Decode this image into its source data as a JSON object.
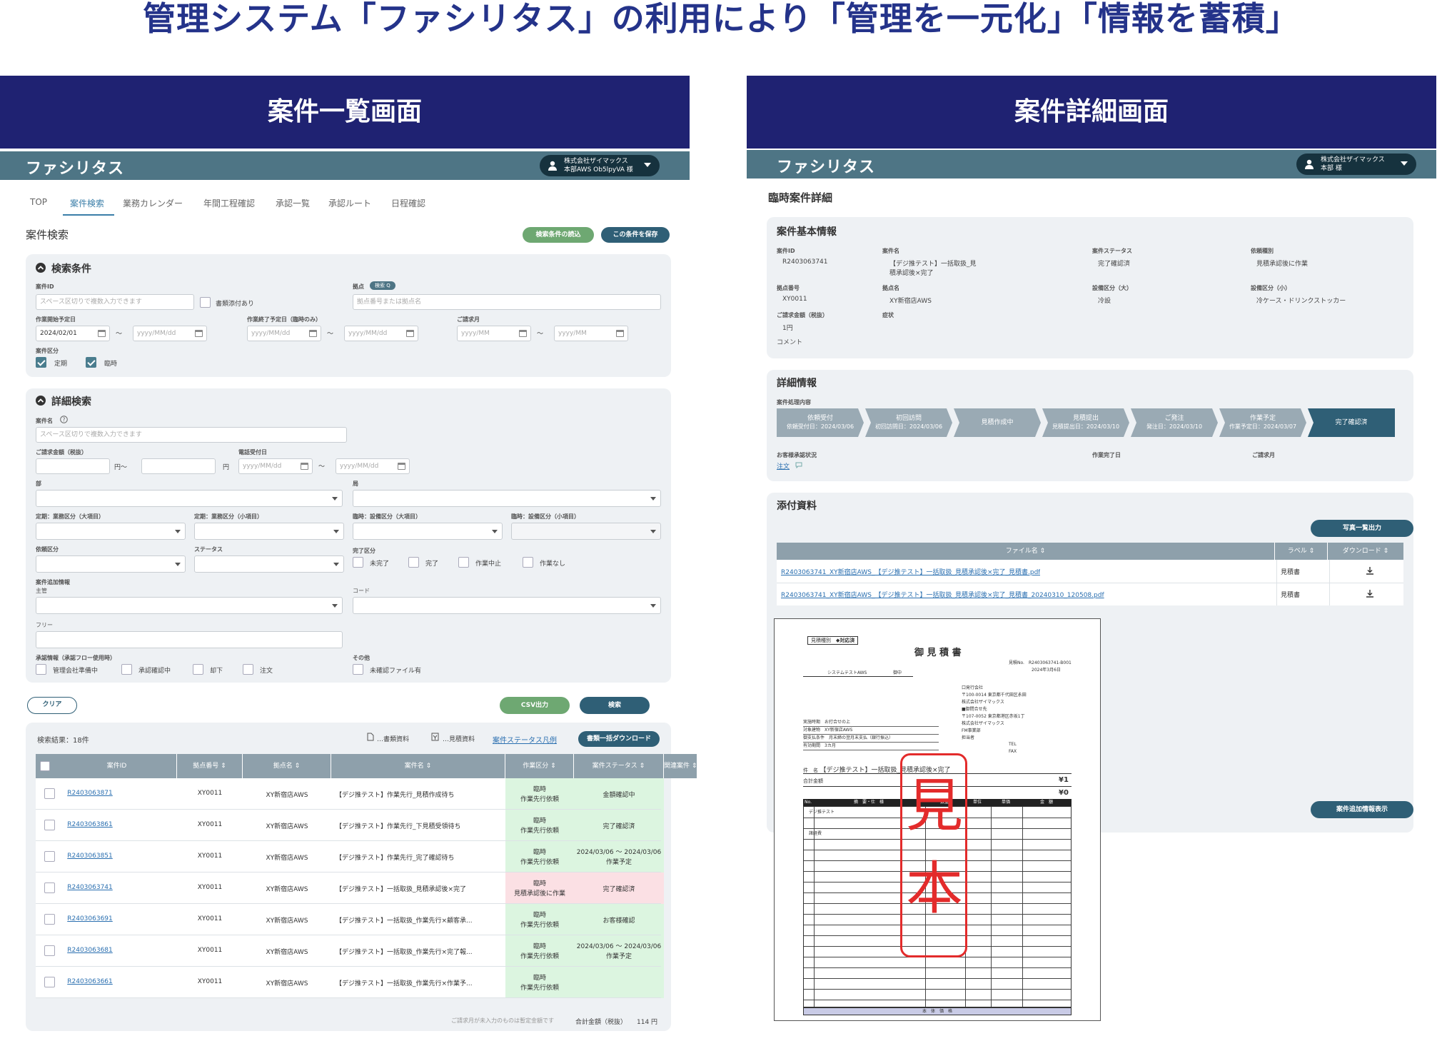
{
  "headline": "管理システム「ファシリタス」の利用により「管理を一元化」「情報を蓄積」",
  "left": {
    "banner": "案件一覧画面",
    "logo": "ファシリタス",
    "user": {
      "line1": "株式会社ザイマックス",
      "line2": "本部AWS Ob5lpyVA 様"
    },
    "tabs": [
      "TOP",
      "案件検索",
      "業務カレンダー",
      "年間工程確認",
      "承認一覧",
      "承認ルート",
      "日程確認"
    ],
    "page_title": "案件検索",
    "btn_load": "検索条件の読込",
    "btn_save": "この条件を保存",
    "cond": {
      "title": "検索条件",
      "case_id_label": "案件ID",
      "case_id_ph": "スペース区切りで複数入力できます",
      "attach_label": "書類添付あり",
      "site_label": "拠点",
      "site_badge": "検索 Q",
      "site_ph": "拠点番号または拠点名",
      "start_label": "作業開始予定日",
      "start_val": "2024/02/01",
      "date_ph": "yyyy/MM/dd",
      "tilde": "〜",
      "end_label": "作業終了予定日（臨時のみ）",
      "bill_label": "ご請求月",
      "month_ph": "yyyy/MM",
      "kind_label": "案件区分",
      "kind_a": "定期",
      "kind_b": "臨時"
    },
    "detail": {
      "title": "詳細検索",
      "name_label": "案件名",
      "name_ph": "スペース区切りで複数入力できます",
      "amount_label": "ご請求金額（税抜）",
      "yen_from": "円〜",
      "yen": "円",
      "tel_label": "電話受付日",
      "bu_label": "部",
      "ka_label": "局",
      "t_big": "定期：業務区分（大項目）",
      "t_small": "定期：業務区分（小項目）",
      "r_big": "臨時：設備区分（大項目）",
      "r_small": "臨時：設備区分（小項目）",
      "req_label": "依頼区分",
      "status_label": "ステータス",
      "done_label": "完了区分",
      "done_opts": [
        "未完了",
        "完了",
        "作業中止",
        "作業なし"
      ],
      "extra_label": "案件追加情報",
      "owner_label": "主管",
      "code_label": "コード",
      "free_label": "フリー",
      "approve_label": "承認情報（承認フロー使用時）",
      "approve_opts": [
        "管理会社準備中",
        "承認確認中",
        "却下",
        "注文"
      ],
      "other_label": "その他",
      "other_opt": "未確認ファイル有"
    },
    "btn_clear": "クリア",
    "btn_csv": "CSV出力",
    "btn_search": "検索",
    "results": {
      "count": "検索結果：18件",
      "legend1": "…書類資料",
      "legend2": "…見積資料",
      "legend_link": "案件ステータス凡例",
      "btn_bulk": "書類一括ダウンロード",
      "headers": [
        "案件ID",
        "拠点番号",
        "拠点名",
        "案件名",
        "作業区分",
        "案件ステータス",
        "関連案件"
      ],
      "rows": [
        {
          "id": "R2403063871",
          "no": "XY0011",
          "site": "XY新宿店AWS",
          "name": "【デジ推テスト】作業先行_見積作成待ち",
          "kind": "臨時\n作業先行依頼",
          "status": "金額確認中",
          "pink": false
        },
        {
          "id": "R2403063861",
          "no": "XY0011",
          "site": "XY新宿店AWS",
          "name": "【デジ推テスト】作業先行_下見積受領待ち",
          "kind": "臨時\n作業先行依頼",
          "status": "完了確認済",
          "pink": false
        },
        {
          "id": "R2403063851",
          "no": "XY0011",
          "site": "XY新宿店AWS",
          "name": "【デジ推テスト】作業先行_完了確認待ち",
          "kind": "臨時\n作業先行依頼",
          "status": "2024/03/06 〜 2024/03/06\n作業予定",
          "pink": false
        },
        {
          "id": "R2403063741",
          "no": "XY0011",
          "site": "XY新宿店AWS",
          "name": "【デジ推テスト】一括取扱_見積承認後×完了",
          "kind": "臨時\n見積承認後に作業",
          "status": "完了確認済",
          "pink": true
        },
        {
          "id": "R2403063691",
          "no": "XY0011",
          "site": "XY新宿店AWS",
          "name": "【デジ推テスト】一括取扱_作業先行×顧客承...",
          "kind": "臨時\n作業先行依頼",
          "status": "お客様確認",
          "pink": false
        },
        {
          "id": "R2403063681",
          "no": "XY0011",
          "site": "XY新宿店AWS",
          "name": "【デジ推テスト】一括取扱_作業先行×完了報...",
          "kind": "臨時\n作業先行依頼",
          "status": "2024/03/06 〜 2024/03/06\n作業予定",
          "pink": false
        },
        {
          "id": "R2403063661",
          "no": "XY0011",
          "site": "XY新宿店AWS",
          "name": "【デジ推テスト】一括取扱_作業先行×作業予...",
          "kind": "臨時\n作業先行依頼",
          "status": "",
          "pink": false
        }
      ],
      "footer_note": "ご請求月が未入力のものは暫定金額です",
      "total_label": "合計金額（税抜）",
      "total_value": "114 円"
    }
  },
  "right": {
    "banner": "案件詳細画面",
    "logo": "ファシリタス",
    "user": {
      "line1": "株式会社ザイマックス",
      "line2": "本部 様"
    },
    "page_title": "臨時案件詳細",
    "basic": {
      "title": "案件基本情報",
      "id_label": "案件ID",
      "id_val": "R2403063741",
      "name_label": "案件名",
      "name_val1": "【デジ推テスト】一括取扱_見",
      "name_val2": "積承認後×完了",
      "status_label": "案件ステータス",
      "status_val": "完了確認済",
      "req_label": "依頼種別",
      "req_val": "見積承認後に作業",
      "siteno_label": "拠点番号",
      "siteno_val": "XY0011",
      "site_label": "拠点名",
      "site_val": "XY新宿店AWS",
      "eqbig_label": "設備区分（大）",
      "eqbig_val": "冷設",
      "eqsmall_label": "設備区分（小）",
      "eqsmall_val": "冷ケース・ドリンクストッカー",
      "amount_label": "ご請求金額（税抜）",
      "amount_val": "1円",
      "symptom_label": "症状",
      "comment_label": "コメント"
    },
    "detail": {
      "title": "詳細情報",
      "proc_label": "案件処理内容",
      "steps": [
        {
          "t": "依頼受付",
          "d": "依頼受付日：2024/03/06"
        },
        {
          "t": "初回訪問",
          "d": "初回訪問日：2024/03/06"
        },
        {
          "t": "見積作成中",
          "d": ""
        },
        {
          "t": "見積提出",
          "d": "見積提出日：2024/03/10"
        },
        {
          "t": "ご発注",
          "d": "発注日：2024/03/10"
        },
        {
          "t": "作業予定",
          "d": "作業予定日：2024/03/07"
        },
        {
          "t": "完了確認済",
          "d": ""
        }
      ],
      "approve_label": "お客様承認状況",
      "approve_link": "注文",
      "done_label": "作業完了日",
      "bill_label": "ご請求月"
    },
    "attach": {
      "title": "添付資料",
      "btn_photo": "写真一覧出力",
      "headers": [
        "ファイル名",
        "ラベル",
        "ダウンロード"
      ],
      "files": [
        {
          "name": "R2403063741_XY新宿店AWS_【デジ推テスト】一括取扱_見積承認後×完了_見積書.pdf",
          "label": "見積書"
        },
        {
          "name": "R2403063741_XY新宿店AWS_【デジ推テスト】一括取扱_見積承認後×完了_見積書_20240310_120508.pdf",
          "label": "見積書"
        }
      ],
      "btn_more": "案件追加情報表示"
    },
    "quote": {
      "tag1": "見積種別",
      "tag2": "◆対応済",
      "title": "御 見 積 書",
      "no": "見積No.　R2403063741-B001",
      "date": "2024年3月6日",
      "client": "システムテストAWS",
      "onchu": "御中",
      "issuer": [
        "口発行会社",
        "〒100-0014 東京都千代田区永田",
        "株式会社ザイマックス",
        "■御問合せ先",
        "〒107-0052 東京都港区赤坂1丁",
        "株式会社ザイマックス",
        "FM事業部",
        "担当者"
      ],
      "tel": "TEL",
      "fax": "FAX",
      "meta": [
        "実施時期　お打合せの上",
        "対象建物　XY新宿店AWS",
        "御支払条件　月末締の翌月末支払（銀行振込）",
        "有効期間　3カ月"
      ],
      "kenmei_label": "件　名",
      "kenmei": "【デジ推テスト】一括取扱_見積承認後×完了",
      "total_label": "合計金額",
      "total": "¥1",
      "zero": "¥0",
      "cols": [
        "No.",
        "摘　要・仕　様",
        "数量",
        "単位",
        "単価",
        "金　額"
      ],
      "item1": "デジ推テスト",
      "item2": "諸経費",
      "footer": "本　体　価　格",
      "stamp": "見本"
    }
  }
}
